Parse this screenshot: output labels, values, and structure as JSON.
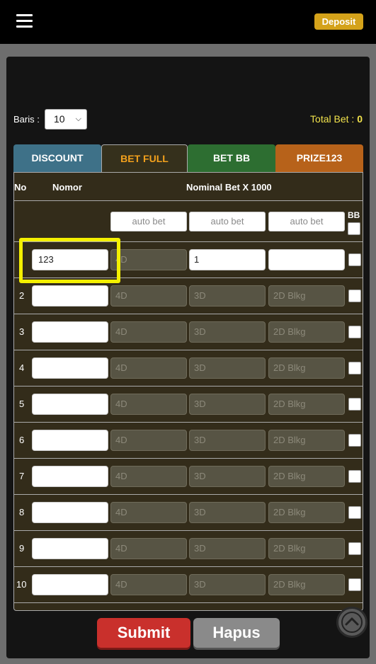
{
  "header": {
    "deposit_label": "Deposit"
  },
  "controls": {
    "baris_label": "Baris :",
    "baris_value": "10",
    "total_bet_label": "Total Bet :",
    "total_bet_value": "0"
  },
  "tabs": [
    {
      "label": "DISCOUNT"
    },
    {
      "label": "BET FULL"
    },
    {
      "label": "BET BB"
    },
    {
      "label": "PRIZE123"
    }
  ],
  "table": {
    "col_no": "No",
    "col_nomor": "Nomor",
    "col_nominal": "Nominal Bet X 1000",
    "col_bb": "BB",
    "auto_placeholder": "auto bet",
    "placeholder_4d": "4D",
    "placeholder_3d": "3D",
    "placeholder_2d": "2D Blkg",
    "rows": [
      {
        "no": "",
        "nomor": "123",
        "bet_3d": "1"
      },
      {
        "no": "2"
      },
      {
        "no": "3"
      },
      {
        "no": "4"
      },
      {
        "no": "5"
      },
      {
        "no": "6"
      },
      {
        "no": "7"
      },
      {
        "no": "8"
      },
      {
        "no": "9"
      },
      {
        "no": "10"
      }
    ]
  },
  "actions": {
    "submit_label": "Submit",
    "hapus_label": "Hapus"
  },
  "colors": {
    "accent": "#d4a21a",
    "highlight": "#f4f000",
    "submit": "#c9302c"
  },
  "icons": {
    "menu": "hamburger-icon",
    "scroll": "chevron-up-icon",
    "select": "chevron-down-icon"
  }
}
